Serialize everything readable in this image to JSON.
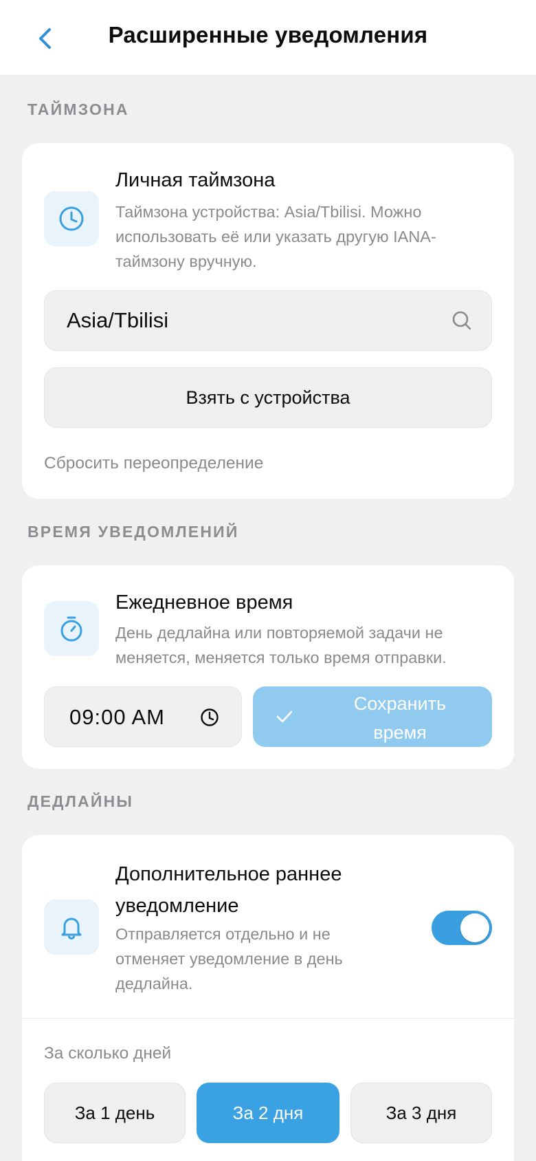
{
  "header": {
    "title": "Расширенные уведомления"
  },
  "timezone_section": {
    "label": "ТАЙМЗОНА",
    "title": "Личная таймзона",
    "description_lines": [
      "Таймзона устройства: Asia/Tbilisi. Можно",
      "использовать её или указать другую IANA-",
      "таймзону вручную."
    ],
    "input_value": "Asia/Tbilisi",
    "device_button": "Взять с устройства",
    "reset_link": "Сбросить переопределение"
  },
  "time_section": {
    "label": "ВРЕМЯ УВЕДОМЛЕНИЙ",
    "title": "Ежедневное время",
    "description_lines": [
      "День дедлайна или повторяемой задачи не",
      "меняется, меняется только время отправки."
    ],
    "time_value": "09:00 AM",
    "save_button_lines": [
      "Сохранить",
      "время"
    ]
  },
  "deadline_section": {
    "label": "ДЕДЛАЙНЫ",
    "title_lines": [
      "Дополнительное раннее",
      "уведомление"
    ],
    "description_lines": [
      "Отправляется отдельно и не",
      "отменяет уведомление в день",
      "дедлайна."
    ],
    "toggle_on": true,
    "days_label": "За сколько дней",
    "options": [
      "За 1 день",
      "За 2 дня",
      "За 3 дня"
    ],
    "selected_option": "За 2 дня"
  },
  "colors": {
    "accent": "#3aa1e2",
    "accent_disabled": "#90caee",
    "icon_tile": "#e8f3fb",
    "background": "#f0f0f1"
  },
  "icons": [
    "chevron-left-icon",
    "clock-icon",
    "search-icon",
    "stopwatch-icon",
    "checkmark-icon",
    "bell-icon"
  ]
}
